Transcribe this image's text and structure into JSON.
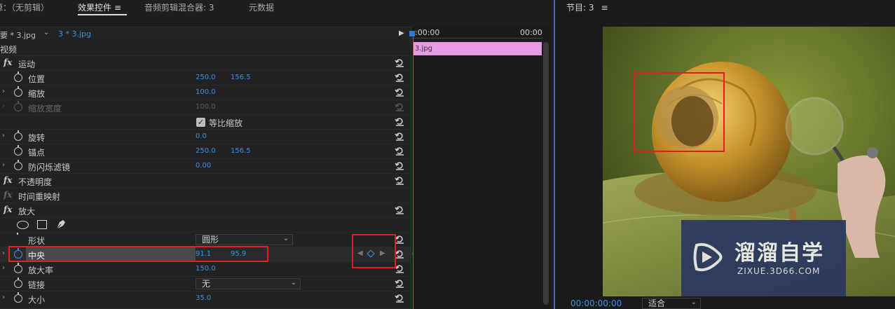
{
  "tabs": {
    "source": "源：（无剪辑）",
    "effect_controls": "效果控件",
    "audio_mixer": "音频剪辑混合器: 3",
    "metadata": "元数据",
    "menu_glyph": "≡"
  },
  "sequence": {
    "master_clip": "要 * 3.jpg",
    "clip": "3 * 3.jpg"
  },
  "timeline": {
    "start_time": ":00:00",
    "end_time": "00:00",
    "clip_name": "3.jpg"
  },
  "effects": {
    "video_header": "视频",
    "motion": "运动",
    "position_label": "位置",
    "position_x": "250.0",
    "position_y": "156.5",
    "scale_label": "缩放",
    "scale_value": "100.0",
    "scale_width_label": "缩放宽度",
    "scale_width_value": "100.0",
    "uniform_scale_label": "等比缩放",
    "rotation_label": "旋转",
    "rotation_value": "0.0",
    "anchor_label": "锚点",
    "anchor_x": "250.0",
    "anchor_y": "156.5",
    "antiflicker_label": "防闪烁滤镜",
    "antiflicker_value": "0.00",
    "opacity_label": "不透明度",
    "time_remap_label": "时间重映射",
    "magnify_label": "放大",
    "shape_label": "形状",
    "shape_value": "圆形",
    "center_label": "中央",
    "center_x": "91.1",
    "center_y": "95.9",
    "magnification_label": "放大率",
    "magnification_value": "150.0",
    "link_label": "链接",
    "link_value": "无",
    "size_label": "大小",
    "size_value": "35.0"
  },
  "program": {
    "title": "节目: 3",
    "timecode": "00:00:00:00",
    "fit_value": "适合",
    "watermark_brand": "溜溜自学",
    "watermark_url": "ZIXUE.3D66.COM"
  },
  "colors": {
    "accent_blue": "#3a8ee6",
    "clip_pink": "#e79be3",
    "highlight_red": "#e02020"
  }
}
